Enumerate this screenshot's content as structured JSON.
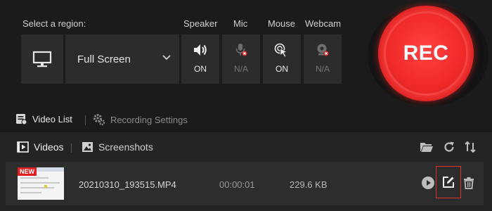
{
  "controls": {
    "region_label": "Select a region:",
    "region_value": "Full Screen",
    "devices": [
      {
        "label": "Speaker",
        "state": "ON",
        "icon": "speaker-icon"
      },
      {
        "label": "Mic",
        "state": "N/A",
        "icon": "mic-icon"
      },
      {
        "label": "Mouse",
        "state": "ON",
        "icon": "mouse-cursor-icon"
      },
      {
        "label": "Webcam",
        "state": "N/A",
        "icon": "webcam-icon"
      }
    ]
  },
  "rec": {
    "label": "REC",
    "color": "#f12a2a"
  },
  "tabs": {
    "video_list": "Video List",
    "recording_settings": "Recording Settings"
  },
  "subtabs": {
    "videos": "Videos",
    "screenshots": "Screenshots"
  },
  "recordings": [
    {
      "badge": "NEW",
      "name": "20210310_193515.MP4",
      "duration": "00:00:01",
      "size": "229.6 KB"
    }
  ],
  "colors": {
    "accent": "#e0302f",
    "na": "#777777"
  }
}
